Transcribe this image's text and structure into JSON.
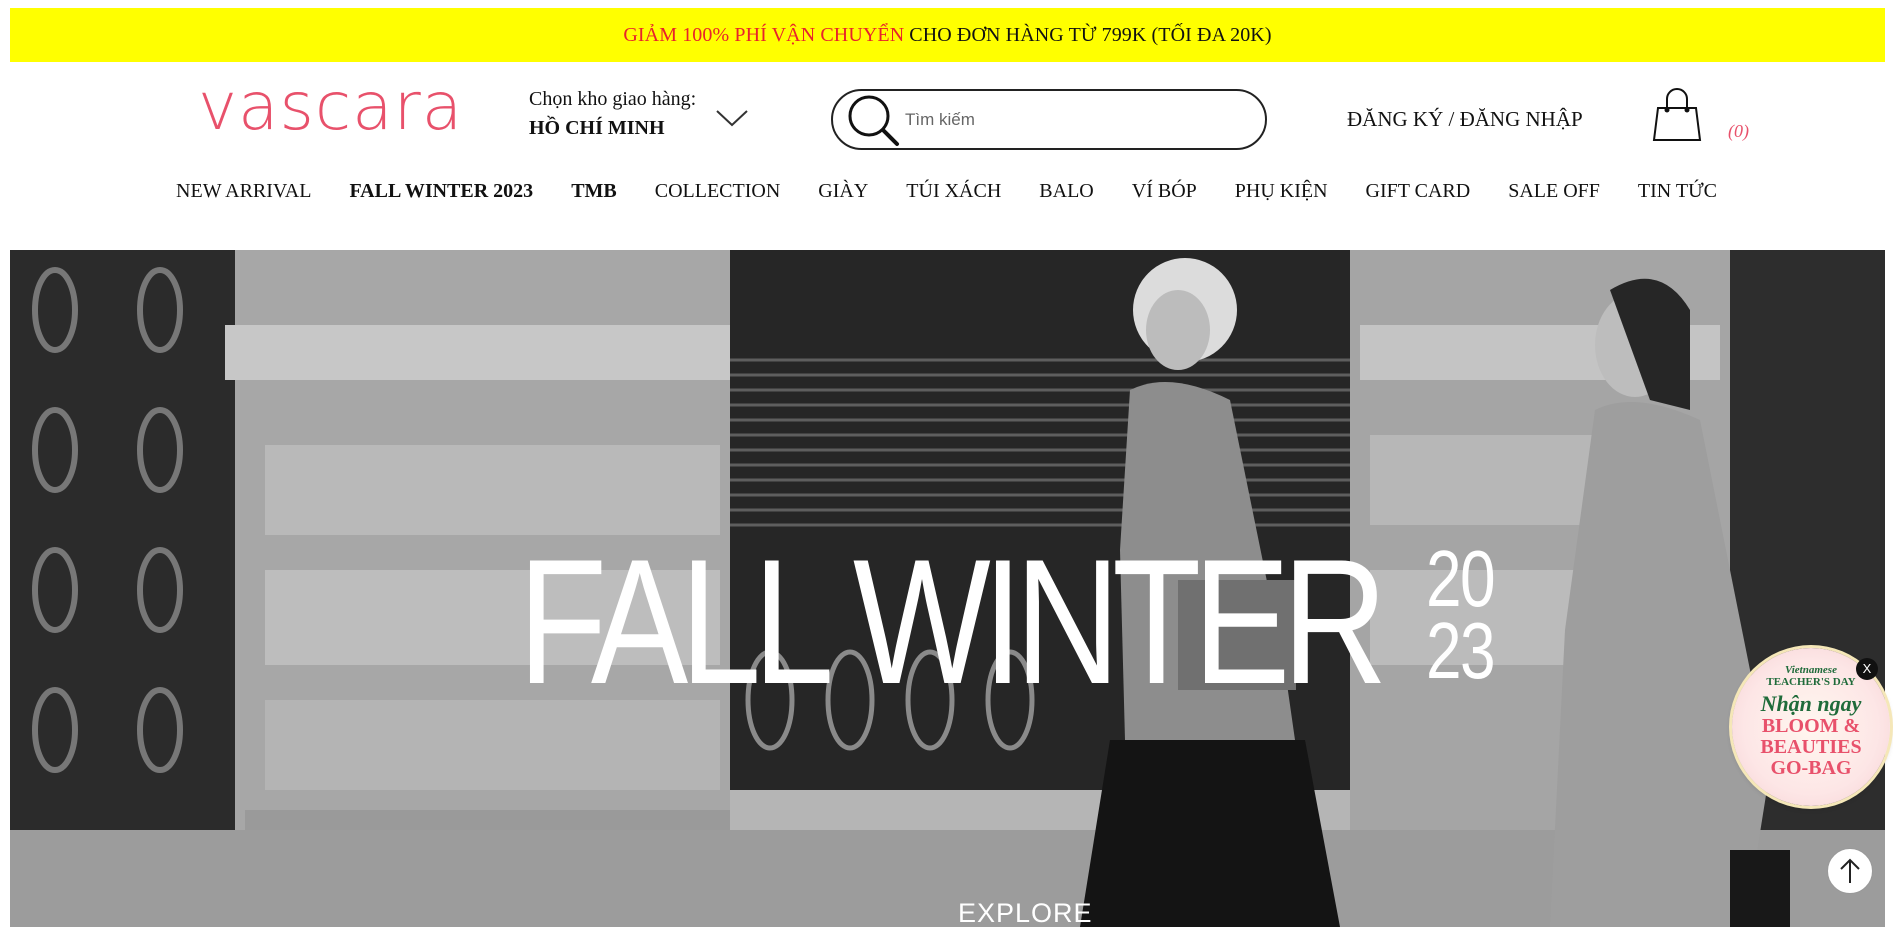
{
  "promo": {
    "highlight": "GIẢM 100% PHÍ VẬN CHUYỂN",
    "rest": "CHO ĐƠN HÀNG TỪ 799K (TỐI ĐA 20K)"
  },
  "header": {
    "logo_text": "vascara",
    "warehouse_label": "Chọn kho giao hàng:",
    "warehouse_value": "HỒ CHÍ MINH",
    "search_placeholder": "Tìm kiếm",
    "auth_label": "ĐĂNG KÝ / ĐĂNG NHẬP",
    "cart_count": "(0)"
  },
  "nav": {
    "items": [
      {
        "label": "NEW ARRIVAL"
      },
      {
        "label": "FALL WINTER 2023"
      },
      {
        "label": "TMB"
      },
      {
        "label": "COLLECTION"
      },
      {
        "label": "GIÀY"
      },
      {
        "label": "TÚI XÁCH"
      },
      {
        "label": "BALO"
      },
      {
        "label": "VÍ BÓP"
      },
      {
        "label": "PHỤ KIỆN"
      },
      {
        "label": "GIFT CARD"
      },
      {
        "label": "SALE OFF"
      },
      {
        "label": "TIN TỨC"
      }
    ]
  },
  "hero": {
    "title": "FALL WINTER",
    "year_top": "20",
    "year_bottom": "23",
    "cta": "EXPLORE"
  },
  "badge": {
    "line1": "Vietnamese",
    "line2": "TEACHER'S DAY",
    "line3": "Nhận ngay",
    "line4": "BLOOM &",
    "line5": "BEAUTIES",
    "line6": "GO-BAG",
    "close": "X"
  },
  "colors": {
    "promo_bg": "#ffff00",
    "promo_highlight": "#e8232b",
    "brand_pink": "#e8516b"
  }
}
